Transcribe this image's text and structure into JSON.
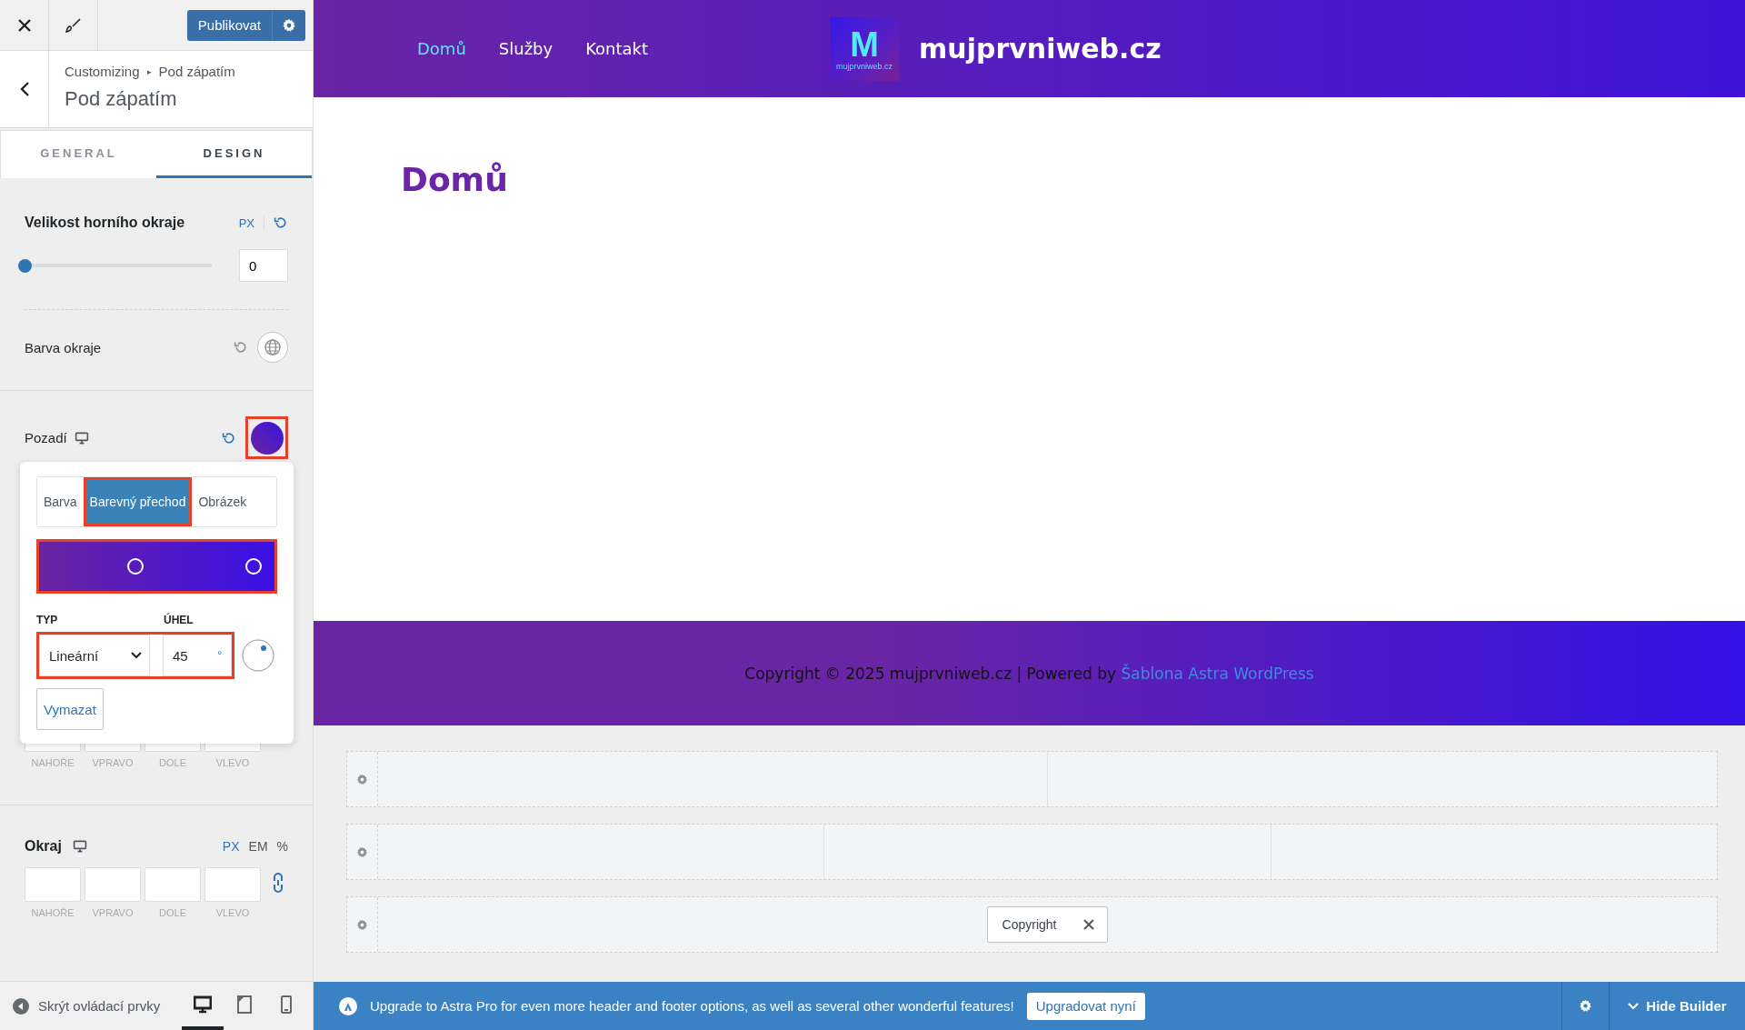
{
  "toolbar": {
    "publish_label": "Publikovat"
  },
  "panel_header": {
    "breadcrumb_root": "Customizing",
    "breadcrumb_separator": "▸",
    "breadcrumb_current": "Pod zápatím",
    "title": "Pod zápatím"
  },
  "tabs": [
    {
      "label": "GENERAL",
      "selected": false
    },
    {
      "label": "DESIGN",
      "selected": true
    }
  ],
  "top_border": {
    "label": "Velikost horního okraje",
    "unit": "PX",
    "level": 0,
    "value": "0"
  },
  "border_color": {
    "label": "Barva okraje"
  },
  "background": {
    "label": "Pozadí",
    "highlighted": true
  },
  "background_popup": {
    "modes": [
      {
        "label": "Barva",
        "selected": false,
        "highlighted": false
      },
      {
        "label": "Barevný přechod",
        "selected": true,
        "highlighted": true
      },
      {
        "label": "Obrázek",
        "selected": false,
        "highlighted": false
      }
    ],
    "gradient_highlighted": true,
    "stops": [
      {
        "level": 0.41
      },
      {
        "level": 0.91
      }
    ],
    "type_label": "TYP",
    "angle_label": "ÚHEL",
    "type_value": "Lineární",
    "angle_value": "45",
    "angle_unit": "°",
    "fields_highlighted": true,
    "clear_label": "Vymazat"
  },
  "padding": {
    "sides": [
      "NAHOŘE",
      "VPRAVO",
      "DOLE",
      "VLEVO"
    ]
  },
  "margin": {
    "label": "Okraj",
    "units": [
      {
        "label": "PX",
        "selected": true
      },
      {
        "label": "EM",
        "selected": false
      },
      {
        "label": "%",
        "selected": false
      }
    ],
    "sides": [
      "NAHOŘE",
      "VPRAVO",
      "DOLE",
      "VLEVO"
    ]
  },
  "bottom_bar": {
    "hide_label": "Skrýt ovládací prvky",
    "devices": [
      {
        "kind": "desktop",
        "selected": true
      },
      {
        "kind": "tablet",
        "selected": false
      },
      {
        "kind": "mobile",
        "selected": false
      }
    ]
  },
  "preview": {
    "nav": [
      {
        "label": "Domů",
        "selected": true
      },
      {
        "label": "Služby",
        "selected": false
      },
      {
        "label": "Kontakt",
        "selected": false
      }
    ],
    "logo_letter": "M",
    "logo_caption": "mujprvniweb.cz",
    "site_title": "mujprvniweb.cz",
    "page_title": "Domů",
    "footer_text": "Copyright © 2025 mujprvniweb.cz | Powered by ",
    "footer_link": "Šablona Astra WordPress"
  },
  "builder": {
    "rows": [
      {
        "kind": "two-column",
        "items": []
      },
      {
        "kind": "three-column",
        "items": []
      },
      {
        "kind": "single",
        "items": [
          "Copyright"
        ]
      }
    ]
  },
  "upgrade_bar": {
    "message": "Upgrade to Astra Pro for even more header and footer options, as well as several other wonderful features!",
    "button": "Upgradovat nyní",
    "hide_label": "Hide Builder"
  }
}
